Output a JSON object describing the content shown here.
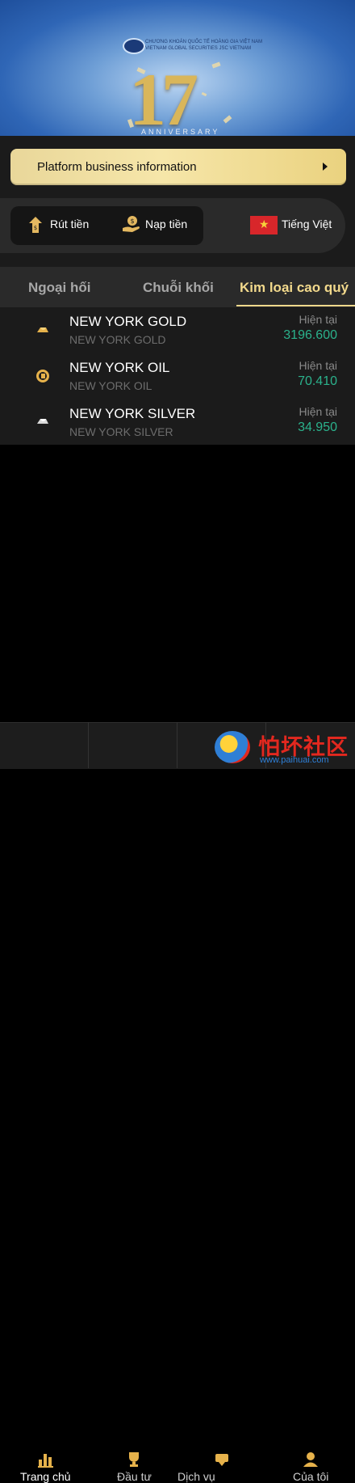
{
  "banner": {
    "number": "17",
    "anniversary": "ANNIVERSARY",
    "logo_line1": "CHƯƠNG KHOÁN QUỐC TẾ HOÀNG GIA VIỆT NAM",
    "logo_line2": "VIETNAM GLOBAL SECURITIES JSC VIETNAM"
  },
  "platform": {
    "label": "Platform business information"
  },
  "actions": {
    "withdraw": "Rút tiền",
    "deposit": "Nạp tiền",
    "language": "Tiếng Việt"
  },
  "tabs": [
    "Ngoại hối",
    "Chuỗi khối",
    "Kim loại cao quý"
  ],
  "active_tab": 2,
  "quotes": [
    {
      "title": "NEW YORK GOLD",
      "subtitle": "NEW YORK GOLD",
      "caption": "Hiện tại",
      "value": "3196.600",
      "icon": "gold-bar-icon"
    },
    {
      "title": "NEW YORK OIL",
      "subtitle": "NEW YORK OIL",
      "caption": "Hiện tại",
      "value": "70.410",
      "icon": "oil-coin-icon"
    },
    {
      "title": "NEW YORK SILVER",
      "subtitle": "NEW YORK SILVER",
      "caption": "Hiện tại",
      "value": "34.950",
      "icon": "silver-bar-icon"
    }
  ],
  "nav": [
    {
      "label": "Trang chủ",
      "icon": "chart-bars-icon"
    },
    {
      "label": "Đầu tư",
      "icon": "trophy-icon"
    },
    {
      "label": "Dịch vụ",
      "icon": "service-icon"
    },
    {
      "label": "Của tôi",
      "icon": "user-icon"
    }
  ],
  "watermark": {
    "text": "怕坏社区",
    "url": "www.paihuai.com"
  },
  "colors": {
    "accent": "#f2d98c",
    "positive": "#2bb28c",
    "button_bg": "#f6e6a9"
  }
}
